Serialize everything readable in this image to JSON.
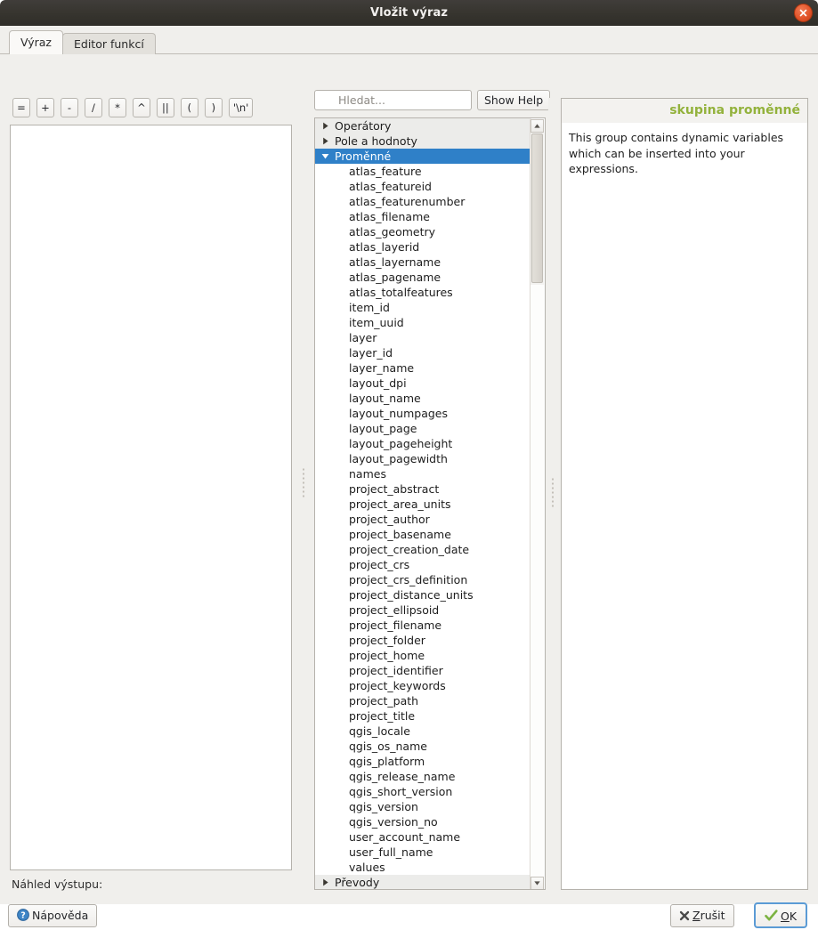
{
  "window": {
    "title": "Vložit výraz",
    "close_icon": "close-icon"
  },
  "tabs": [
    {
      "label": "Výraz",
      "active": true
    },
    {
      "label": "Editor funkcí",
      "active": false
    }
  ],
  "operators": [
    "=",
    "+",
    "-",
    "/",
    "*",
    "^",
    "||",
    "(",
    ")",
    "'\\n'"
  ],
  "expression": {
    "value": "",
    "preview_label": "Náhled výstupu:",
    "preview_value": ""
  },
  "search": {
    "placeholder": "Hledat...",
    "value": "",
    "icon": "search-icon"
  },
  "show_help_button": "Show Help",
  "tree": {
    "groups": [
      {
        "label": "Operátory",
        "expanded": false,
        "selected": false
      },
      {
        "label": "Pole a hodnoty",
        "expanded": false,
        "selected": false
      },
      {
        "label": "Proměnné",
        "expanded": true,
        "selected": true
      },
      {
        "label": "Převody",
        "expanded": false,
        "selected": false
      }
    ],
    "variables": [
      "atlas_feature",
      "atlas_featureid",
      "atlas_featurenumber",
      "atlas_filename",
      "atlas_geometry",
      "atlas_layerid",
      "atlas_layername",
      "atlas_pagename",
      "atlas_totalfeatures",
      "item_id",
      "item_uuid",
      "layer",
      "layer_id",
      "layer_name",
      "layout_dpi",
      "layout_name",
      "layout_numpages",
      "layout_page",
      "layout_pageheight",
      "layout_pagewidth",
      "names",
      "project_abstract",
      "project_area_units",
      "project_author",
      "project_basename",
      "project_creation_date",
      "project_crs",
      "project_crs_definition",
      "project_distance_units",
      "project_ellipsoid",
      "project_filename",
      "project_folder",
      "project_home",
      "project_identifier",
      "project_keywords",
      "project_path",
      "project_title",
      "qgis_locale",
      "qgis_os_name",
      "qgis_platform",
      "qgis_release_name",
      "qgis_short_version",
      "qgis_version",
      "qgis_version_no",
      "user_account_name",
      "user_full_name",
      "values"
    ]
  },
  "help": {
    "header": "skupina proměnné",
    "body": "This group contains dynamic variables which can be inserted into your expressions."
  },
  "buttons": {
    "help": "Nápověda",
    "help_icon": "question-circle-icon",
    "cancel": "Zrušit",
    "cancel_icon": "x-icon",
    "ok": "OK",
    "ok_icon": "check-icon"
  },
  "colors": {
    "selection": "#2f80c8",
    "help_header": "#93b23c",
    "titlebar": "#37352f",
    "close_button": "#e2542a",
    "focus_ring": "#5b9bd5"
  }
}
